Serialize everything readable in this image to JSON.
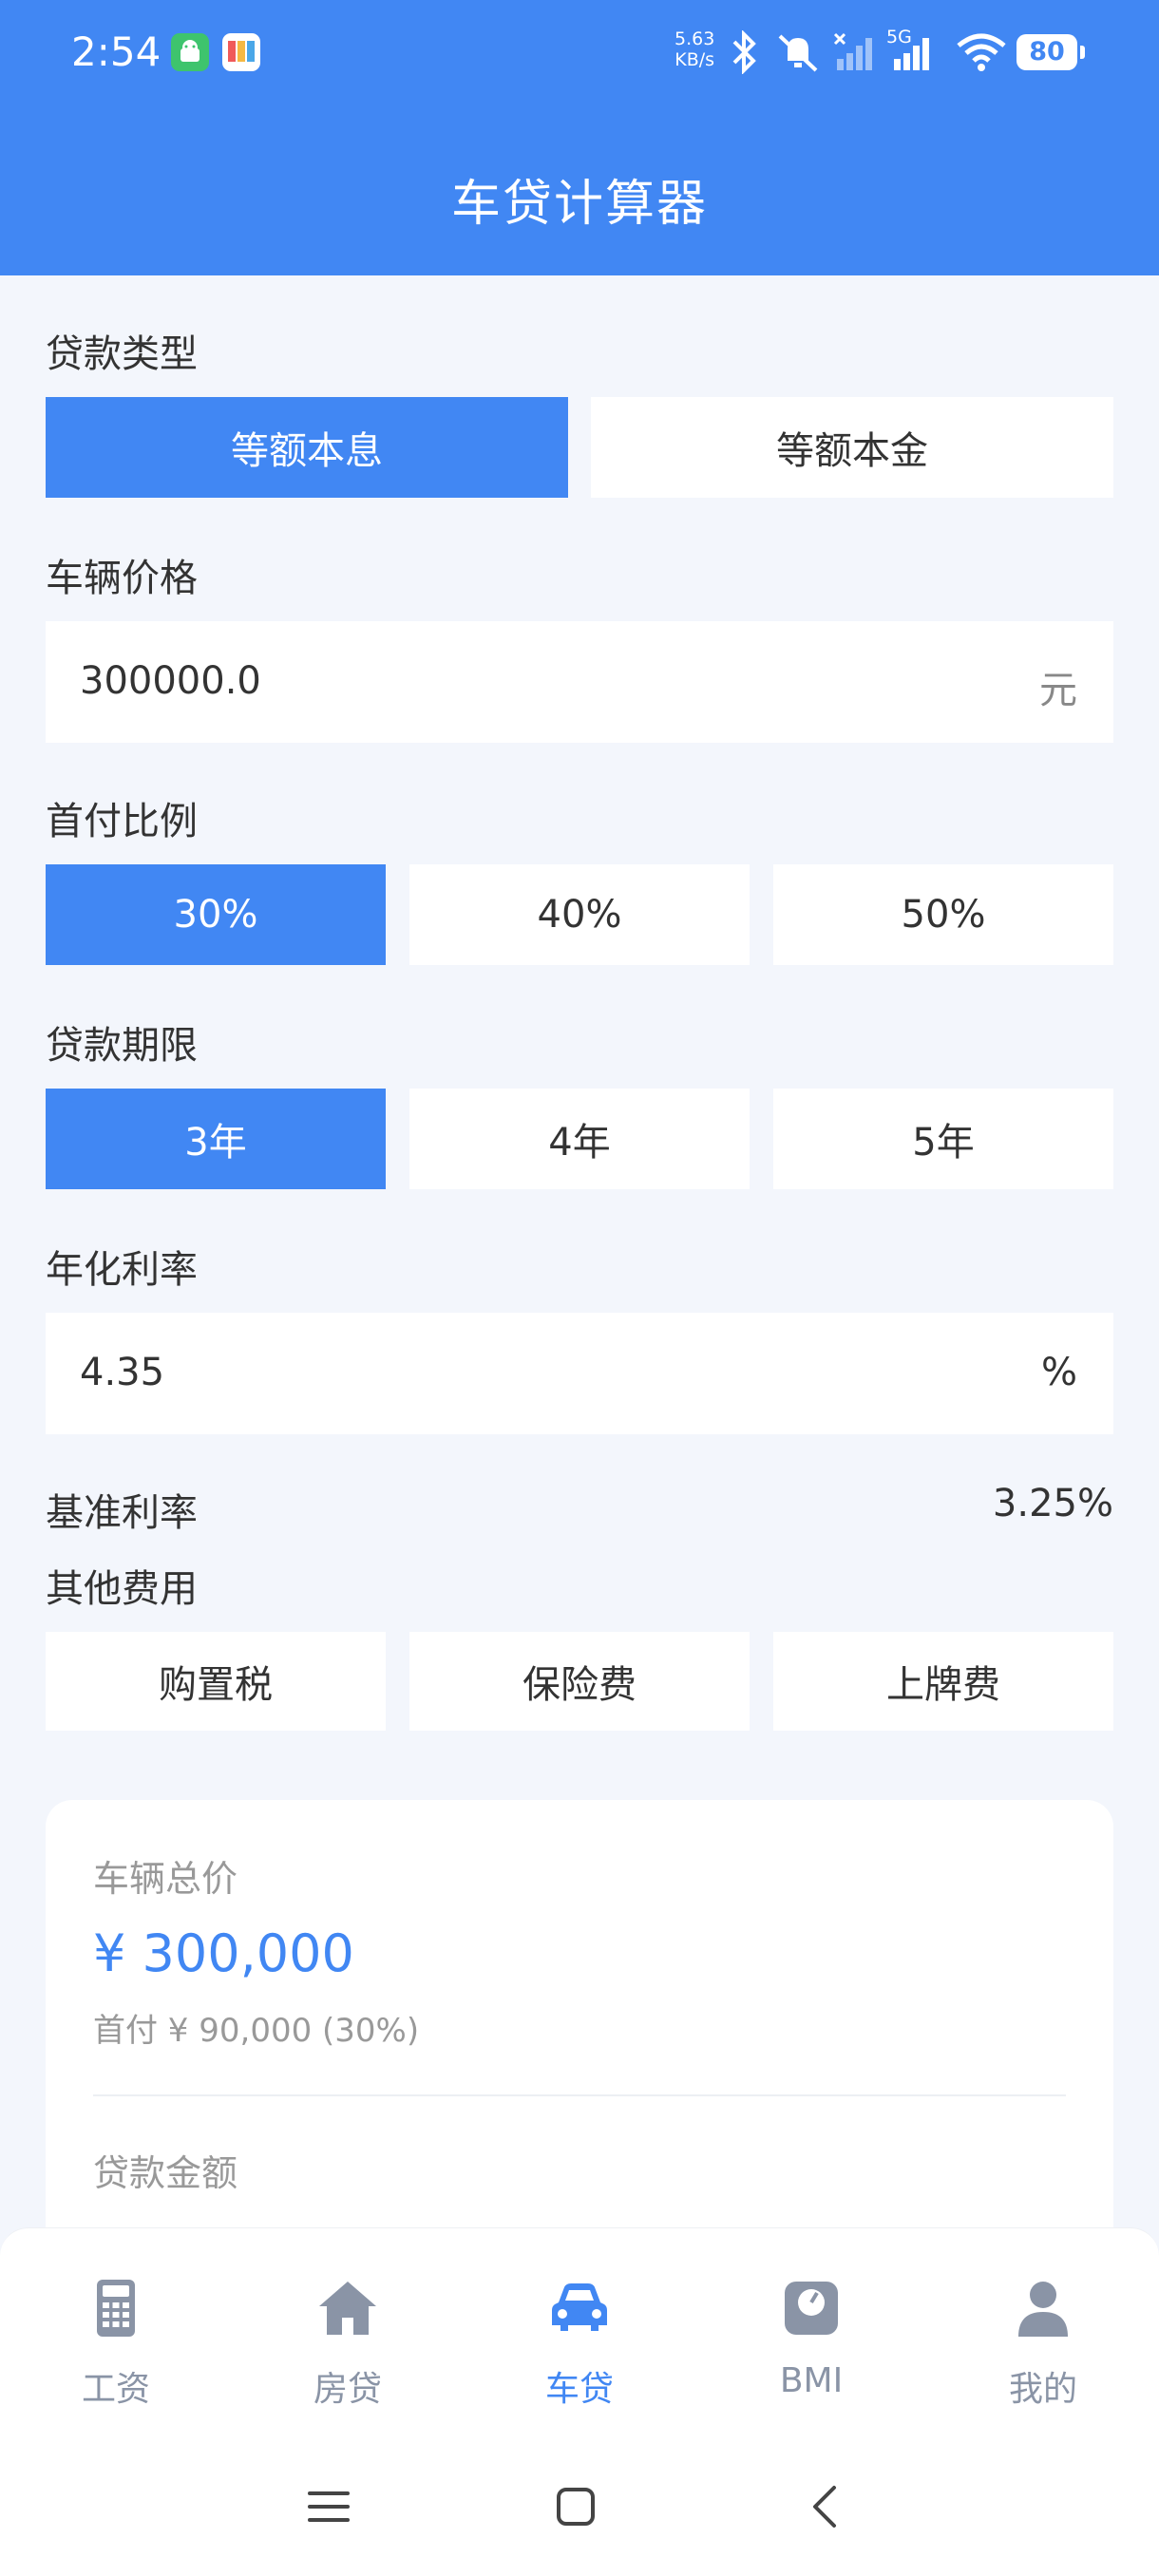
{
  "status_bar": {
    "time": "2:54",
    "net_speed_value": "5.63",
    "net_speed_unit": "KB/s",
    "signal_label": "5G",
    "battery": "80"
  },
  "app_bar": {
    "title": "车贷计算器"
  },
  "loan_type": {
    "label": "贷款类型",
    "options": [
      "等额本息",
      "等额本金"
    ],
    "selected": "等额本息"
  },
  "vehicle_price": {
    "label": "车辆价格",
    "value": "300000.0",
    "unit": "元"
  },
  "down_payment": {
    "label": "首付比例",
    "options": [
      "30%",
      "40%",
      "50%"
    ],
    "selected": "30%"
  },
  "loan_term": {
    "label": "贷款期限",
    "options": [
      "3年",
      "4年",
      "5年"
    ],
    "selected": "3年"
  },
  "annual_rate": {
    "label": "年化利率",
    "value": "4.35",
    "unit": "%"
  },
  "benchmark_rate": {
    "label": "基准利率",
    "value": "3.25%"
  },
  "other_fees": {
    "label": "其他费用",
    "options": [
      "购置税",
      "保险费",
      "上牌费"
    ]
  },
  "result_card": {
    "total_label": "车辆总价",
    "total_value": "¥ 300,000",
    "down_payment_text": "首付 ¥ 90,000 (30%)",
    "loan_amount_label": "贷款金额"
  },
  "tabs": [
    {
      "label": "工资",
      "icon": "calculator-icon"
    },
    {
      "label": "房贷",
      "icon": "house-icon"
    },
    {
      "label": "车贷",
      "icon": "car-icon"
    },
    {
      "label": "BMI",
      "icon": "scale-icon"
    },
    {
      "label": "我的",
      "icon": "person-icon"
    }
  ],
  "active_tab": "车贷",
  "colors": {
    "primary": "#4187f3",
    "background": "#f3f6fc",
    "inactive": "#8a94a6"
  }
}
